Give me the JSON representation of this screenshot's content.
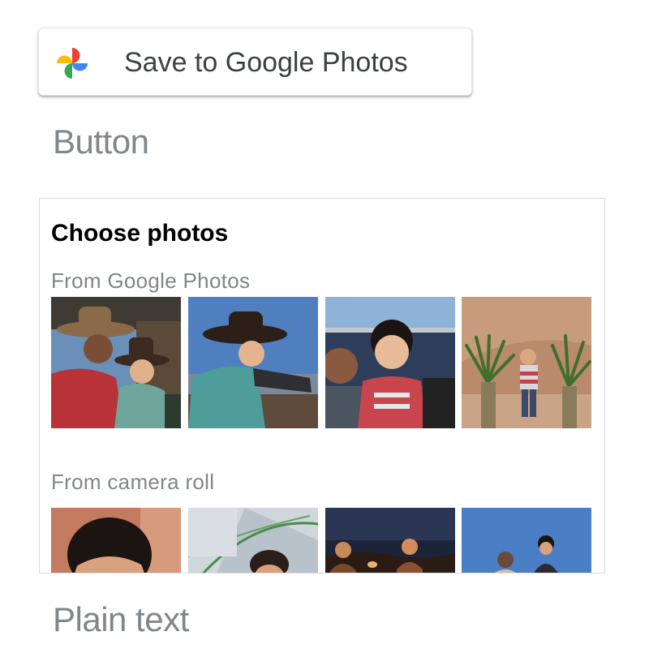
{
  "save_button": {
    "label": "Save to Google Photos",
    "logo_icon": "google-photos-pinwheel-icon"
  },
  "captions": {
    "button": "Button",
    "plain_text": "Plain text"
  },
  "picker": {
    "title": "Choose photos",
    "sections": [
      {
        "label": "From Google Photos",
        "photos": [
          "father-and-son-in-cowboy-hats-photo",
          "boy-in-cowboy-hat-and-teal-vest-photo",
          "smiling-boy-by-vehicle-photo",
          "boy-between-desert-yuccas-photo"
        ]
      },
      {
        "label": "From camera roll",
        "photos": [
          "boy-closeup-red-rocks-photo",
          "child-in-tent-photo",
          "campfire-at-dusk-photo",
          "two-people-under-blue-sky-photo"
        ]
      }
    ]
  },
  "colors": {
    "logo_yellow": "#fbbc04",
    "logo_red": "#ea4335",
    "logo_blue": "#4285f4",
    "logo_green": "#34a853",
    "caption_gray": "#80868b",
    "border_gray": "#dadce0"
  }
}
